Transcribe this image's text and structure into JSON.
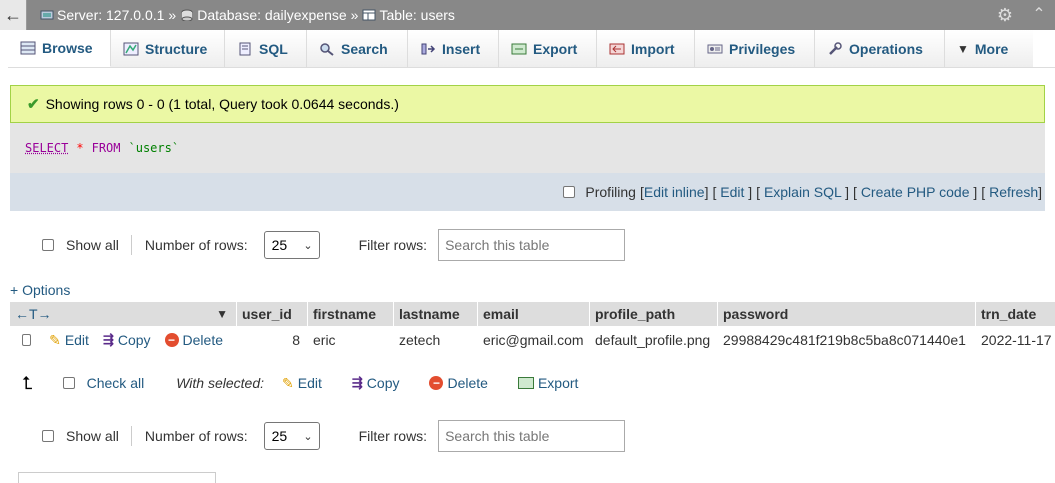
{
  "breadcrumb": {
    "server": "Server: 127.0.0.1",
    "sep1": "»",
    "database": "Database: dailyexpense",
    "sep2": "»",
    "table": "Table: users"
  },
  "tabs": [
    {
      "label": "Browse",
      "icon": "browse-icon"
    },
    {
      "label": "Structure",
      "icon": "structure-icon"
    },
    {
      "label": "SQL",
      "icon": "sql-icon"
    },
    {
      "label": "Search",
      "icon": "search-icon"
    },
    {
      "label": "Insert",
      "icon": "insert-icon"
    },
    {
      "label": "Export",
      "icon": "export-icon"
    },
    {
      "label": "Import",
      "icon": "import-icon"
    },
    {
      "label": "Privileges",
      "icon": "privileges-icon"
    },
    {
      "label": "Operations",
      "icon": "operations-icon"
    },
    {
      "label": "More",
      "icon": "chevron-down-icon"
    }
  ],
  "success_message": "Showing rows 0 - 0 (1 total, Query took 0.0644 seconds.)",
  "sql": {
    "select": "SELECT",
    "star": "*",
    "from": "FROM",
    "table": "`users`"
  },
  "sql_links": {
    "profiling": "Profiling",
    "edit_inline": "Edit inline",
    "edit": "Edit",
    "explain": "Explain SQL",
    "create_php": "Create PHP code",
    "refresh": "Refresh"
  },
  "nav": {
    "show_all": "Show all",
    "number_of_rows": "Number of rows:",
    "rows_value": "25",
    "filter_rows": "Filter rows:",
    "search_placeholder": "Search this table"
  },
  "options_link": "+ Options",
  "table": {
    "columns": [
      "user_id",
      "firstname",
      "lastname",
      "email",
      "profile_path",
      "password",
      "trn_date"
    ],
    "row": {
      "edit": "Edit",
      "copy": "Copy",
      "delete": "Delete",
      "user_id": "8",
      "firstname": "eric",
      "lastname": "zetech",
      "email": "eric@gmail.com",
      "profile_path": "default_profile.png",
      "password": "29988429c481f219b8c5ba8c071440e1",
      "trn_date": "2022-11-17"
    }
  },
  "bulk": {
    "check_all": "Check all",
    "with_selected": "With selected:",
    "edit": "Edit",
    "copy": "Copy",
    "delete": "Delete",
    "export": "Export"
  },
  "colors": {
    "link": "#235a81",
    "success_bg": "#ebf8a4",
    "header_bg": "#888888"
  }
}
